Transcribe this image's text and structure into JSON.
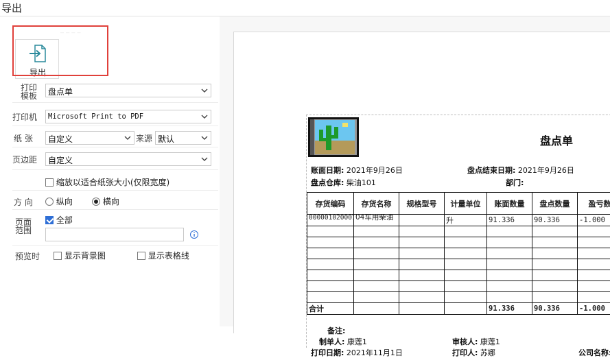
{
  "window": {
    "title": "导出"
  },
  "toolbar": {
    "export_label": "导出"
  },
  "form": {
    "template": {
      "label": "打印模板",
      "label_line1": "打印",
      "label_line2": "模板",
      "value": "盘点单"
    },
    "printer": {
      "label": "打印机",
      "value": "Microsoft Print to PDF"
    },
    "paper": {
      "label": "纸 张",
      "value": "自定义",
      "source_label": "来源",
      "source_value": "默认"
    },
    "margin": {
      "label": "页边距",
      "value": "自定义"
    },
    "fit_width": {
      "label": "缩放以适合纸张大小(仅限宽度)",
      "checked": false
    },
    "orientation": {
      "label": "方 向",
      "portrait": "纵向",
      "landscape": "横向",
      "selected": "横向"
    },
    "page_range": {
      "label_line1": "页面",
      "label_line2": "范围",
      "all_label": "全部",
      "all_checked": true,
      "input_placeholder": ""
    },
    "preview": {
      "label": "预览时",
      "show_bg": "显示背景图",
      "show_grid": "显示表格线",
      "show_bg_checked": false,
      "show_grid_checked": false
    }
  },
  "document": {
    "title": "盘点单",
    "account_date_label": "账面日期:",
    "account_date": "2021年9月26日",
    "end_date_label": "盘点结束日期:",
    "end_date": "2021年9月26日",
    "warehouse_label": "盘点仓库:",
    "warehouse": "柴油101",
    "department_label": "部门:",
    "department": "",
    "columns": [
      "存货编码",
      "存货名称",
      "规格型号",
      "计量单位",
      "账面数量",
      "盘点数量",
      "盈亏数量"
    ],
    "rows": [
      {
        "code": "000001020007",
        "name": "04车用柴油",
        "spec": "",
        "unit": "升",
        "book_qty": "91.336",
        "count_qty": "90.336",
        "diff_qty": "-1.000"
      }
    ],
    "empty_rows": 7,
    "total": {
      "label": "合计",
      "book_qty": "91.336",
      "count_qty": "90.336",
      "diff_qty": "-1.000"
    },
    "remark_label": "备注:",
    "maker_label": "制单人:",
    "maker": "康莲1",
    "reviewer_label": "审核人:",
    "reviewer": "康莲1",
    "print_date_label": "打印日期:",
    "print_date": "2021年11月1日",
    "printer_label": "打印人:",
    "printer_name": "苏娜",
    "company_label": "公司名称:"
  },
  "colors": {
    "highlight_box": "#e0403a",
    "checkbox_checked": "#2f6fd6"
  }
}
